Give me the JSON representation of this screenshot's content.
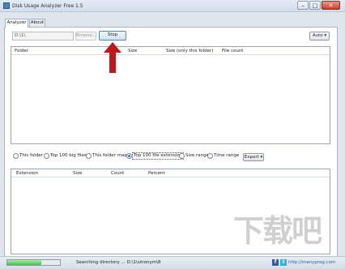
{
  "window": {
    "title": "Disk Usage Analyzer Free 1.5",
    "minimize": "–",
    "maximize": "□",
    "close": "✕"
  },
  "tabs": [
    {
      "label": "Analyzer"
    },
    {
      "label": "About"
    }
  ],
  "toolbar": {
    "path_value": "D:\\1\\",
    "browse_label": "Browse...",
    "stop_label": "Stop",
    "auto_label": "Auto ▾"
  },
  "folders_table": {
    "columns": [
      "Folder",
      "Size",
      "Size (only this folder)",
      "File count"
    ]
  },
  "view_options": {
    "options": [
      "This folder",
      "Top 100 big files",
      "This folder map",
      "Top 100 file extension",
      "Size range",
      "Time range"
    ],
    "selected": "Top 100 file extension",
    "export_label": "Export ▾"
  },
  "ext_table": {
    "columns": [
      "Extension",
      "Size",
      "Count",
      "Percent"
    ]
  },
  "status": {
    "progress": 0.65,
    "text": "Searching directory ... D:\\1\\sinonym\\8",
    "facebook": "f",
    "twitter": "t",
    "link": "http://manyprog.com"
  },
  "watermark": "下载吧",
  "colors": {
    "arrow": "#c0171b",
    "progress": "#42c14a",
    "link": "#2a5db0"
  }
}
